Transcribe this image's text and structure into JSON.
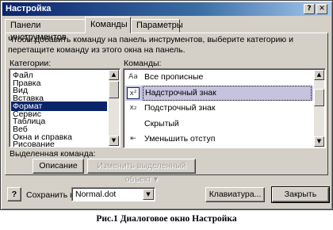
{
  "window": {
    "title": "Настройка",
    "help_glyph": "?",
    "close_glyph": "✕"
  },
  "tabs": [
    {
      "label": "Панели инструментов",
      "active": false
    },
    {
      "label": "Команды",
      "active": true
    },
    {
      "label": "Параметры",
      "active": false
    }
  ],
  "hint": "Чтобы добавить команду на панель инструментов, выберите категорию и перетащите команду из этого окна на панель.",
  "categories": {
    "label": "Категории:",
    "selected": "Формат",
    "items": [
      "Файл",
      "Правка",
      "Вид",
      "Вставка",
      "Формат",
      "Сервис",
      "Таблица",
      "Веб",
      "Окна и справка",
      "Рисование"
    ]
  },
  "commands": {
    "label": "Команды:",
    "selected": "Надстрочный знак",
    "items": [
      {
        "label": "Все прописные",
        "icon": "all-caps-icon",
        "glyph": "Aa"
      },
      {
        "label": "Надстрочный знак",
        "icon": "superscript-icon",
        "glyph": "x²"
      },
      {
        "label": "Подстрочный знак",
        "icon": "subscript-icon",
        "glyph": "x₂"
      },
      {
        "label": "Скрытый",
        "icon": "hidden-text-icon",
        "glyph": ""
      },
      {
        "label": "Уменьшить отступ",
        "icon": "decrease-indent-icon",
        "glyph": "⇤"
      }
    ]
  },
  "selected_command": {
    "label": "Выделенная команда:",
    "description_button": "Описание",
    "modify_selection_button": "Изменить выделенный объект ▾"
  },
  "footer": {
    "save_in_label": "Сохранить в:",
    "save_in_value": "Normal.dot",
    "keyboard_button": "Клавиатура...",
    "close_button": "Закрыть",
    "help_icon_glyph": "?"
  },
  "caption": "Рис.1 Диалоговое окно Настройка"
}
